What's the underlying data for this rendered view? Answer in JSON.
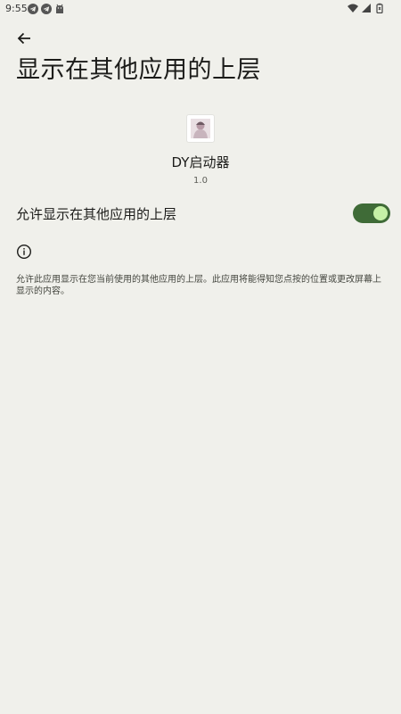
{
  "status_bar": {
    "time": "9:55",
    "left_icons": [
      "telegram-icon",
      "telegram-icon",
      "android-icon"
    ],
    "right_icons": [
      "wifi-icon",
      "signal-icon",
      "battery-icon"
    ]
  },
  "header": {
    "back_icon": "arrow-back-icon",
    "title": "显示在其他应用的上层"
  },
  "app": {
    "name": "DY启动器",
    "version": "1.0"
  },
  "permission": {
    "label": "允许显示在其他应用的上层",
    "enabled": true
  },
  "info": {
    "icon": "info-icon",
    "text": "允许此应用显示在您当前使用的其他应用的上层。此应用将能得知您点按的位置或更改屏幕上显示的内容。"
  },
  "colors": {
    "background": "#f0f0eb",
    "switch_track": "#3f6b37",
    "switch_thumb": "#c6f1a6"
  }
}
